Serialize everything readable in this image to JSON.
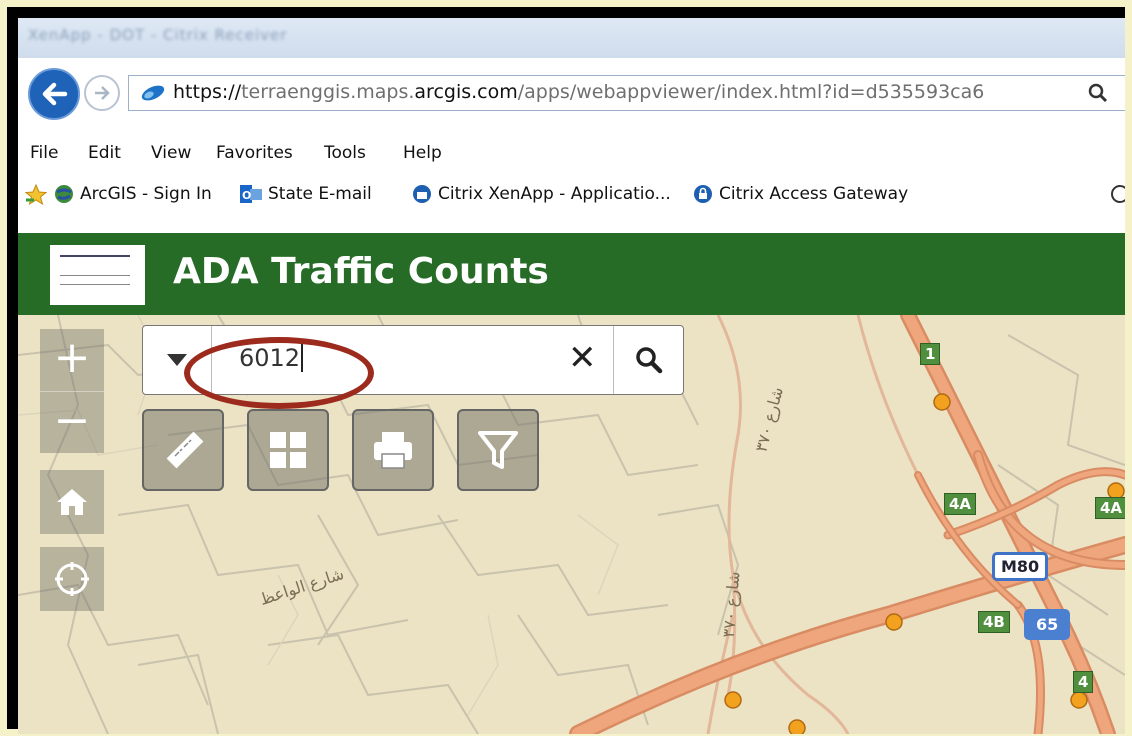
{
  "browser": {
    "window_title": "XenApp - DOT - Citrix Receiver",
    "url_prefix": "https://",
    "url_domain_pre": "terraenggis.maps.",
    "url_domain_main": "arcgis.com",
    "url_path": "/apps/webappviewer/index.html?id=d535593ca6",
    "menu": [
      "File",
      "Edit",
      "View",
      "Favorites",
      "Tools",
      "Help"
    ],
    "favorites": [
      "ArcGIS - Sign In",
      "State E-mail",
      "Citrix XenApp - Applicatio...",
      "Citrix Access Gateway"
    ]
  },
  "app": {
    "title": "ADA Traffic Counts",
    "header_color": "#266b26"
  },
  "search": {
    "value": "6012",
    "highlight_color": "#9c2b1e"
  },
  "map_controls": {
    "zoom_in": "+",
    "zoom_out": "−",
    "clear": "✕",
    "tools": [
      "ruler-icon",
      "grid-icon",
      "print-icon",
      "filter-icon"
    ]
  },
  "map_labels": {
    "road_1": "1",
    "road_4a_left": "4A",
    "road_4a_right": "4A",
    "road_m80": "M80",
    "road_4b": "4B",
    "road_65": "65",
    "road_4": "4",
    "street_1": "شارع الواعظ",
    "street_2": "شارع ٣٧٠",
    "street_3": "شارع ٣٧٠"
  }
}
